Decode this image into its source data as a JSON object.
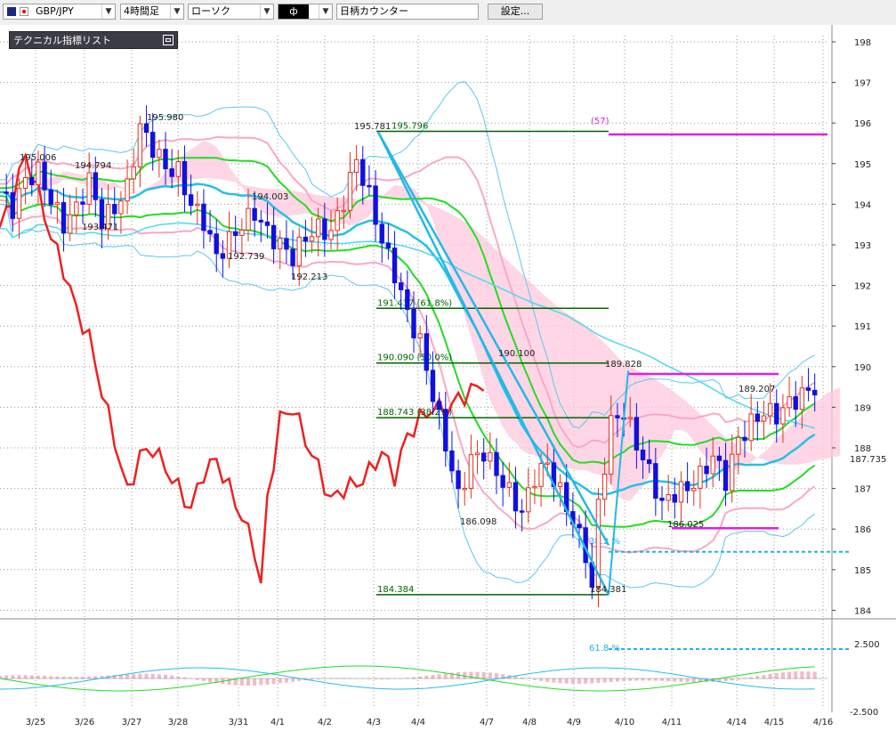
{
  "toolbar": {
    "symbol": "GBP/JPY",
    "timeframe": "4時間足",
    "chart_style": "ローソク",
    "draw_tool": "ф",
    "counter": "日柄カウンター",
    "settings": "設定..."
  },
  "indicator_list": {
    "label": "テクニカル指標リスト"
  },
  "colors": {
    "bull_candle": "#e03020",
    "bear_candle": "#1010e0",
    "bollinger_outer": "#5bc8ee",
    "bollinger_inner": "#f8a8c8",
    "ma_green": "#22dd22",
    "ma_cyan": "#22c0e8",
    "lagging_span": "#ee2020",
    "cloud": "#ffc8dc",
    "cloud_blue": "#c0dcf4",
    "fibonacci": "#006400",
    "target_line": "#e020e0"
  },
  "chart_data": {
    "type": "candlestick",
    "symbol": "GBP/JPY",
    "timeframe": "4時間足",
    "price_axis": {
      "ticks": [
        "198",
        "197",
        "196",
        "195",
        "194",
        "193",
        "192",
        "191",
        "190",
        "189",
        "188",
        "187",
        "186",
        "185",
        "184"
      ],
      "current_price": "187.735"
    },
    "oscillator_axis": {
      "ticks": [
        "2.500",
        "-2.500"
      ]
    },
    "date_axis": [
      "3/25",
      "3/26",
      "3/27",
      "3/28",
      "3/31",
      "4/1",
      "4/2",
      "4/3",
      "4/4",
      "4/7",
      "4/8",
      "4/9",
      "4/10",
      "4/11",
      "4/14",
      "4/15",
      "4/16"
    ],
    "price_labels": [
      "195.006",
      "194.794",
      "193.471",
      "195.980",
      "194.003",
      "192.739",
      "192.213",
      "195.781",
      "186.098",
      "190.100",
      "189.828",
      "184.381",
      "189.207",
      "186.025"
    ],
    "fibonacci": [
      {
        "label": "195.796",
        "price": 195.796
      },
      {
        "label": "191.437 (61.8%)",
        "price": 191.437
      },
      {
        "label": "190.090 (50.0%)",
        "price": 190.09
      },
      {
        "label": "188.743 (38.2%)",
        "price": 188.743
      },
      {
        "label": "184.384",
        "price": 184.384
      }
    ],
    "annotations": [
      "(57)",
      "38.2 %",
      "61.8 %"
    ],
    "close_path": [
      [
        0,
        194.3
      ],
      [
        2,
        193.9
      ],
      [
        4,
        194.6
      ],
      [
        6,
        194.8
      ],
      [
        8,
        194.1
      ],
      [
        10,
        193.5
      ],
      [
        12,
        193.9
      ],
      [
        14,
        194.6
      ],
      [
        16,
        193.6
      ],
      [
        18,
        193.9
      ],
      [
        20,
        194.4
      ],
      [
        22,
        195.9
      ],
      [
        24,
        195.4
      ],
      [
        26,
        194.9
      ],
      [
        28,
        194.8
      ],
      [
        30,
        194.0
      ],
      [
        32,
        193.6
      ],
      [
        34,
        192.7
      ],
      [
        36,
        193.1
      ],
      [
        38,
        193.5
      ],
      [
        40,
        193.8
      ],
      [
        42,
        193.3
      ],
      [
        44,
        193.0
      ],
      [
        46,
        192.7
      ],
      [
        48,
        193.2
      ],
      [
        50,
        193.4
      ],
      [
        52,
        193.3
      ],
      [
        54,
        194.1
      ],
      [
        55,
        194.6
      ],
      [
        56,
        195.1
      ],
      [
        58,
        194.2
      ],
      [
        60,
        193.1
      ],
      [
        62,
        192.3
      ],
      [
        64,
        191.3
      ],
      [
        66,
        190.6
      ],
      [
        68,
        189.3
      ],
      [
        70,
        188.1
      ],
      [
        72,
        186.8
      ],
      [
        74,
        187.7
      ],
      [
        76,
        187.9
      ],
      [
        78,
        187.4
      ],
      [
        80,
        186.9
      ],
      [
        82,
        186.4
      ],
      [
        84,
        187.3
      ],
      [
        86,
        187.6
      ],
      [
        88,
        186.9
      ],
      [
        90,
        186.2
      ],
      [
        92,
        185.4
      ],
      [
        93,
        184.5
      ],
      [
        94,
        186.6
      ],
      [
        96,
        188.6
      ],
      [
        98,
        188.9
      ],
      [
        100,
        188.1
      ],
      [
        102,
        187.4
      ],
      [
        104,
        186.6
      ],
      [
        106,
        186.9
      ],
      [
        108,
        187.0
      ],
      [
        110,
        187.3
      ],
      [
        112,
        187.8
      ],
      [
        114,
        187.2
      ],
      [
        116,
        188.2
      ],
      [
        118,
        188.6
      ],
      [
        120,
        188.9
      ],
      [
        122,
        188.8
      ],
      [
        124,
        189.1
      ],
      [
        126,
        189.3
      ],
      [
        128,
        189.5
      ]
    ]
  }
}
